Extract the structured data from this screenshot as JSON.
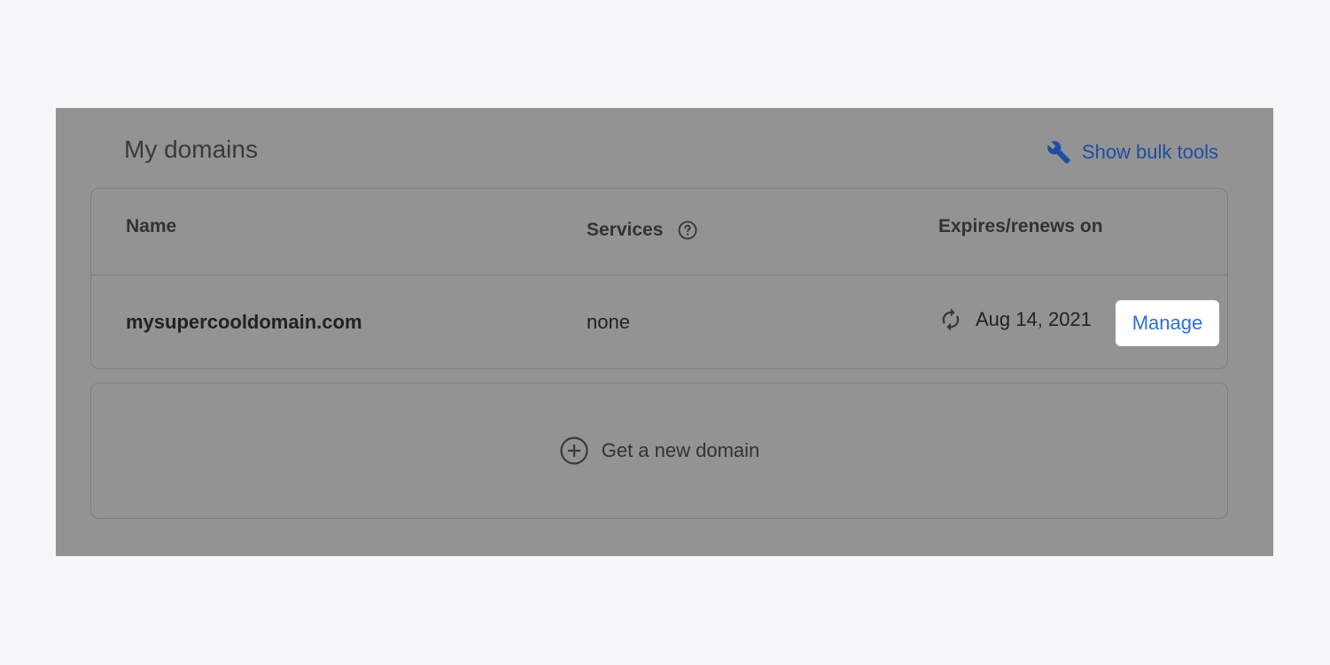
{
  "header": {
    "title": "My domains",
    "bulk_tools_label": "Show bulk tools",
    "bulk_tools_icon": "wrench-icon"
  },
  "table": {
    "columns": {
      "name": "Name",
      "services": "Services",
      "expires": "Expires/renews on"
    },
    "rows": [
      {
        "domain": "mysupercooldomain.com",
        "services": "none",
        "renews_on": "Aug 14, 2021",
        "renew_icon": "autorenew-icon",
        "action_label": "Manage"
      }
    ]
  },
  "new_domain": {
    "label": "Get a new domain",
    "icon": "plus-circle-icon"
  },
  "colors": {
    "page_bg": "#f5f6f8",
    "overlay": "#939393",
    "link_blue": "#1f4fa0",
    "button_text_blue": "#2f6fd0",
    "button_bg": "#ffffff"
  }
}
